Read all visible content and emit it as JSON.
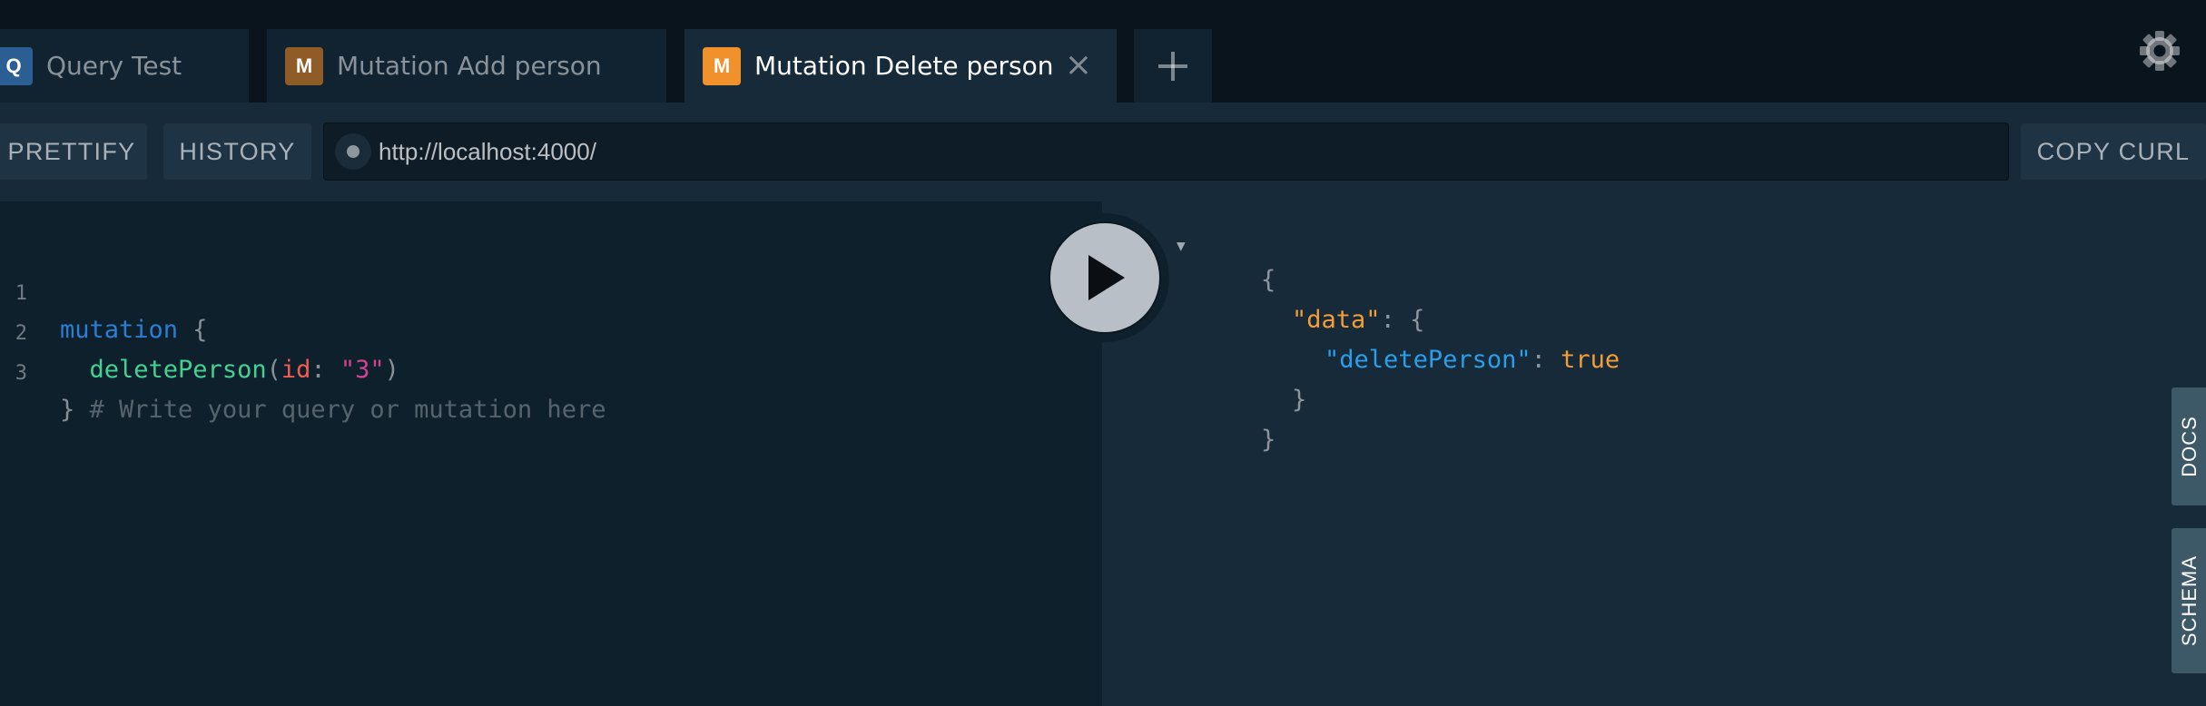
{
  "tabs": [
    {
      "badge": "Q",
      "label": "Query Test",
      "badge_color": "#2b5e93",
      "active": false
    },
    {
      "badge": "M",
      "label": "Mutation Add person",
      "badge_color": "#8f5b26",
      "active": false
    },
    {
      "badge": "M",
      "label": "Mutation Delete person",
      "badge_color": "#f0912c",
      "active": true,
      "close_icon": "×"
    }
  ],
  "tab_add_icon": "plus-icon",
  "settings_icon": "gear-icon",
  "toolbar": {
    "prettify_label": "PRETTIFY",
    "history_label": "HISTORY",
    "endpoint_url": "http://localhost:4000/",
    "copy_curl_label": "COPY CURL"
  },
  "editor": {
    "line_numbers": [
      "1",
      "2",
      "3"
    ],
    "line1": {
      "keyword": "mutation",
      "brace": " {"
    },
    "line2": {
      "indent": "  ",
      "field": "deletePerson",
      "open_paren": "(",
      "arg": "id",
      "colon": ": ",
      "value": "\"3\"",
      "close_paren": ")"
    },
    "line3": {
      "brace": "} ",
      "comment": "# Write your query or mutation here"
    }
  },
  "result": {
    "open_brace": "{",
    "data_key": "\"data\"",
    "colon": ": ",
    "data_open": "{",
    "field_key": "\"deletePerson\"",
    "field_value": "true",
    "data_close": "}",
    "close_brace": "}"
  },
  "run_icon": "play-icon",
  "side_tabs": {
    "docs": "DOCS",
    "schema": "SCHEMA"
  },
  "colors": {
    "background": "#0f202d",
    "keyword": "#2a7ed3",
    "field": "#42d392",
    "argument": "#f25c54",
    "string": "#d64292",
    "result_key": "#f49d37",
    "result_field": "#2a9ee8"
  }
}
